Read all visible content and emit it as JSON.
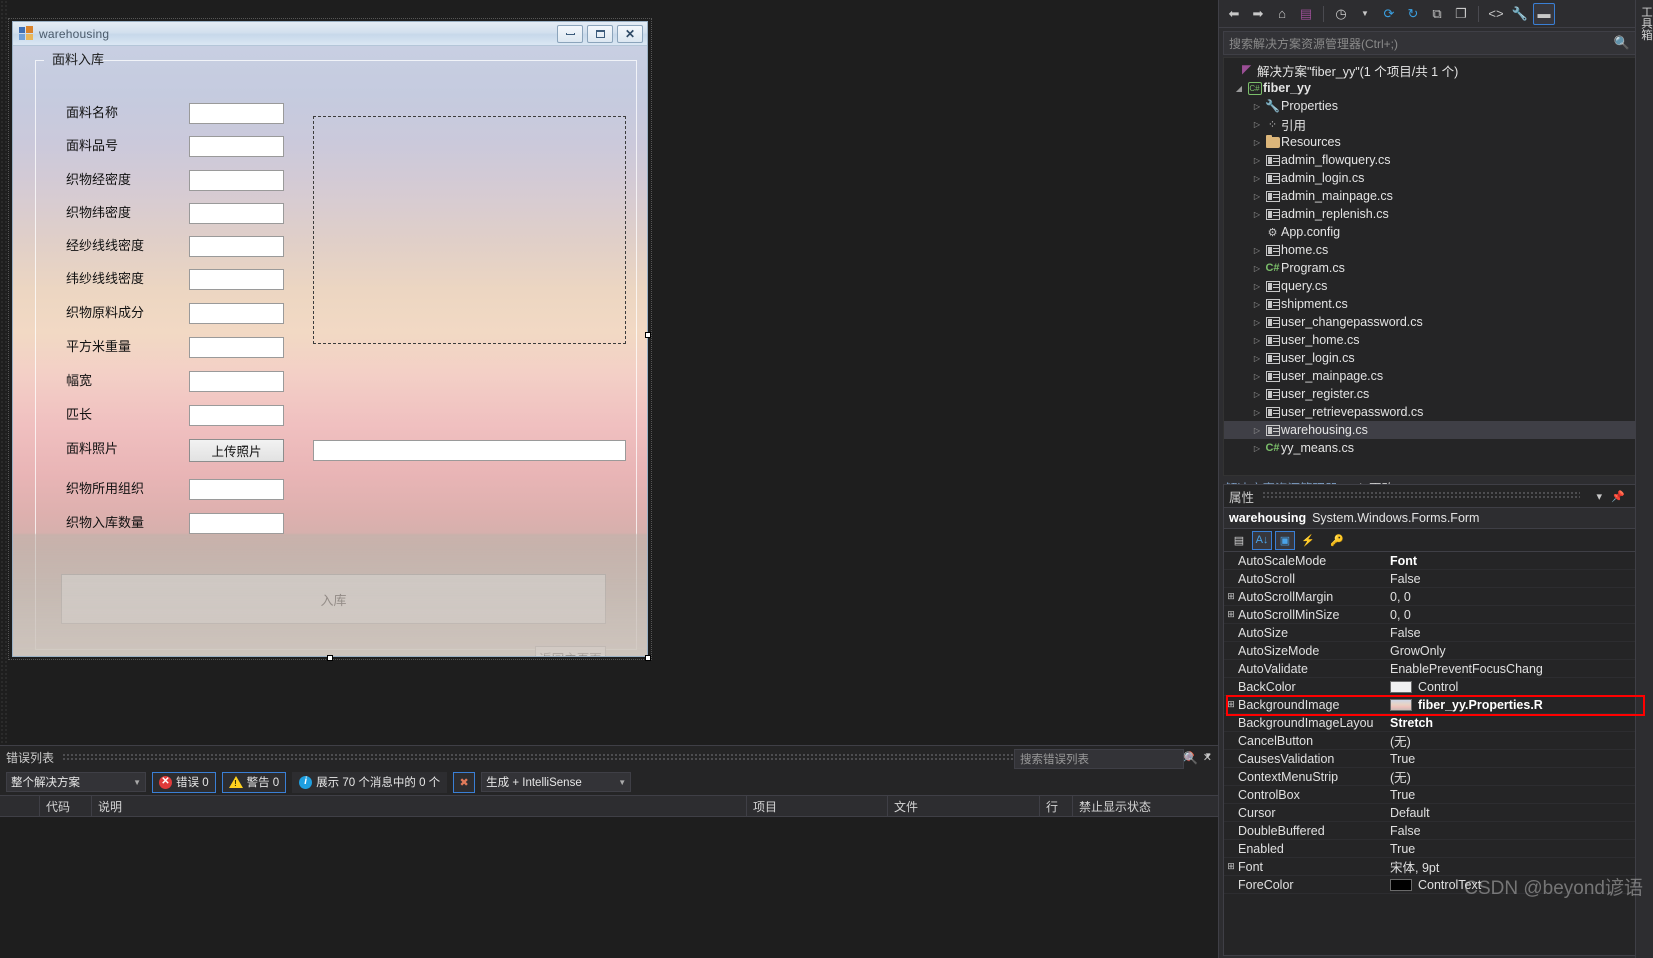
{
  "designer": {
    "form": {
      "title": "warehousing",
      "window_buttons": {
        "minimize": "—",
        "maximize": "□",
        "close": "✕"
      },
      "groupbox_legend": "面料入库",
      "fields": [
        {
          "label": "面料名称",
          "value": ""
        },
        {
          "label": "面料品号",
          "value": ""
        },
        {
          "label": "织物经密度",
          "value": ""
        },
        {
          "label": "织物纬密度",
          "value": ""
        },
        {
          "label": "经纱线线密度",
          "value": ""
        },
        {
          "label": "纬纱线线密度",
          "value": ""
        },
        {
          "label": "织物原料成分",
          "value": ""
        },
        {
          "label": "平方米重量",
          "value": ""
        },
        {
          "label": "幅宽",
          "value": ""
        },
        {
          "label": "匹长",
          "value": ""
        }
      ],
      "photo_row": {
        "label": "面料照片",
        "button": "上传照片",
        "path_value": ""
      },
      "tail_fields": [
        {
          "label": "织物所用组织",
          "value": ""
        },
        {
          "label": "织物入库数量",
          "value": ""
        }
      ],
      "submit_button": "入库",
      "back_button": "返回主页面"
    }
  },
  "error_list": {
    "title": "错误列表",
    "scope": "整个解决方案",
    "errors_label": "错误 0",
    "warnings_label": "警告 0",
    "messages_label": "展示 70 个消息中的 0 个",
    "build_filter": "生成 + IntelliSense",
    "search_placeholder": "搜索错误列表",
    "columns": [
      "代码",
      "说明",
      "项目",
      "文件",
      "行",
      "禁止显示状态"
    ],
    "rows": []
  },
  "solution_explorer": {
    "search_placeholder": "搜索解决方案资源管理器(Ctrl+;)",
    "solution_node": "解决方案\"fiber_yy\"(1 个项目/共 1 个)",
    "project_node": "fiber_yy",
    "items": [
      {
        "label": "Properties",
        "icon": "wrench-icon",
        "arrow": true,
        "indent": 2
      },
      {
        "label": "引用",
        "icon": "references-icon",
        "arrow": true,
        "indent": 2
      },
      {
        "label": "Resources",
        "icon": "folder-icon",
        "arrow": true,
        "indent": 2
      },
      {
        "label": "admin_flowquery.cs",
        "icon": "form-icon",
        "arrow": true,
        "indent": 2
      },
      {
        "label": "admin_login.cs",
        "icon": "form-icon",
        "arrow": true,
        "indent": 2
      },
      {
        "label": "admin_mainpage.cs",
        "icon": "form-icon",
        "arrow": true,
        "indent": 2
      },
      {
        "label": "admin_replenish.cs",
        "icon": "form-icon",
        "arrow": true,
        "indent": 2
      },
      {
        "label": "App.config",
        "icon": "config-icon",
        "arrow": false,
        "indent": 2
      },
      {
        "label": "home.cs",
        "icon": "form-icon",
        "arrow": true,
        "indent": 2
      },
      {
        "label": "Program.cs",
        "icon": "csharp-icon",
        "arrow": true,
        "indent": 2
      },
      {
        "label": "query.cs",
        "icon": "form-icon",
        "arrow": true,
        "indent": 2
      },
      {
        "label": "shipment.cs",
        "icon": "form-icon",
        "arrow": true,
        "indent": 2
      },
      {
        "label": "user_changepassword.cs",
        "icon": "form-icon",
        "arrow": true,
        "indent": 2
      },
      {
        "label": "user_home.cs",
        "icon": "form-icon",
        "arrow": true,
        "indent": 2
      },
      {
        "label": "user_login.cs",
        "icon": "form-icon",
        "arrow": true,
        "indent": 2
      },
      {
        "label": "user_mainpage.cs",
        "icon": "form-icon",
        "arrow": true,
        "indent": 2
      },
      {
        "label": "user_register.cs",
        "icon": "form-icon",
        "arrow": true,
        "indent": 2
      },
      {
        "label": "user_retrievepassword.cs",
        "icon": "form-icon",
        "arrow": true,
        "indent": 2
      },
      {
        "label": "warehousing.cs",
        "icon": "form-icon",
        "arrow": true,
        "indent": 2,
        "selected": true
      },
      {
        "label": "yy_means.cs",
        "icon": "csharp-icon",
        "arrow": true,
        "indent": 2
      }
    ],
    "tabs": [
      {
        "label": "解决方案资源管理器",
        "active": true
      },
      {
        "label": "Git 更改",
        "active": false
      }
    ]
  },
  "properties": {
    "title": "属性",
    "object_name": "warehousing",
    "object_type": "System.Windows.Forms.Form",
    "rows": [
      {
        "name": "AutoScaleMode",
        "value": "Font",
        "expand": false,
        "bold": true
      },
      {
        "name": "AutoScroll",
        "value": "False",
        "expand": false
      },
      {
        "name": "AutoScrollMargin",
        "value": "0, 0",
        "expand": true
      },
      {
        "name": "AutoScrollMinSize",
        "value": "0, 0",
        "expand": true
      },
      {
        "name": "AutoSize",
        "value": "False",
        "expand": false
      },
      {
        "name": "AutoSizeMode",
        "value": "GrowOnly",
        "expand": false
      },
      {
        "name": "AutoValidate",
        "value": "EnablePreventFocusChang",
        "expand": false
      },
      {
        "name": "BackColor",
        "value": "Control",
        "expand": false,
        "swatch": "white"
      },
      {
        "name": "BackgroundImage",
        "value": "fiber_yy.Properties.R",
        "expand": true,
        "swatch": "sky",
        "bold": true,
        "highlighted": true
      },
      {
        "name": "BackgroundImageLayou",
        "value": "Stretch",
        "expand": false,
        "bold": true
      },
      {
        "name": "CancelButton",
        "value": "(无)",
        "expand": false
      },
      {
        "name": "CausesValidation",
        "value": "True",
        "expand": false
      },
      {
        "name": "ContextMenuStrip",
        "value": "(无)",
        "expand": false
      },
      {
        "name": "ControlBox",
        "value": "True",
        "expand": false
      },
      {
        "name": "Cursor",
        "value": "Default",
        "expand": false
      },
      {
        "name": "DoubleBuffered",
        "value": "False",
        "expand": false
      },
      {
        "name": "Enabled",
        "value": "True",
        "expand": false
      },
      {
        "name": "Font",
        "value": "宋体, 9pt",
        "expand": true
      },
      {
        "name": "ForeColor",
        "value": "ControlText",
        "expand": false,
        "swatch": "black"
      }
    ]
  },
  "watermark": "CSDN @beyond谚语",
  "right_edge_tab": "工具箱"
}
